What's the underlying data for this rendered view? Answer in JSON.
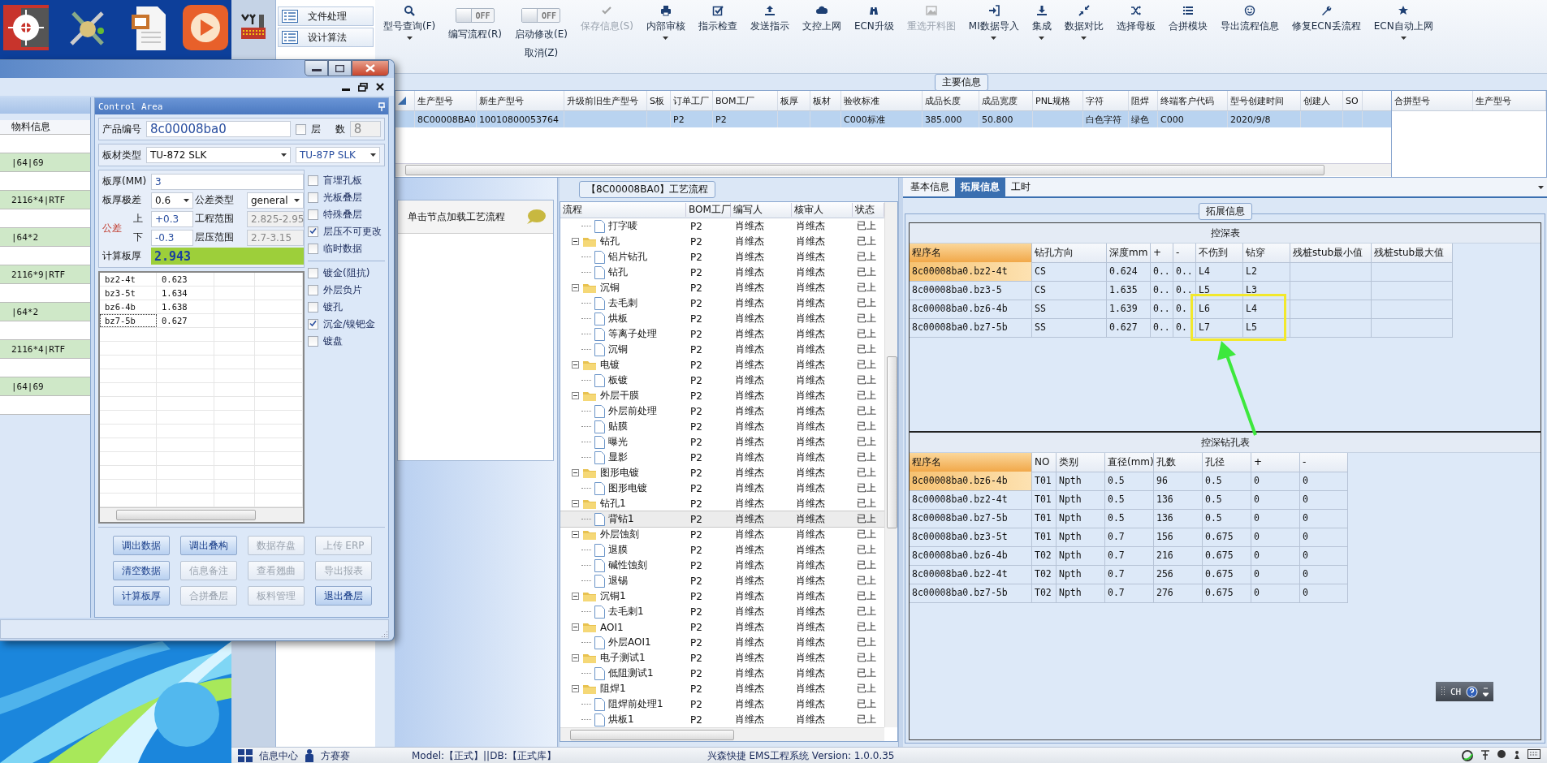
{
  "nav_menu": [
    {
      "label": "文件处理",
      "selected": false
    },
    {
      "label": "设计算法",
      "selected": false
    }
  ],
  "toolbar": [
    {
      "kind": "button",
      "label": "型号查询(F)",
      "dropdown": true,
      "disabled": false
    },
    {
      "kind": "toggle",
      "switch": "OFF",
      "on": false,
      "label": "编写流程(R)"
    },
    {
      "kind": "toggle",
      "switch": "OFF",
      "on": false,
      "label": "启动修改(E)",
      "sublabel": "取消(Z)"
    },
    {
      "kind": "button",
      "label": "保存信息(S)",
      "dropdown": false,
      "disabled": true
    },
    {
      "kind": "button",
      "label": "内部审核",
      "dropdown": true,
      "disabled": false
    },
    {
      "kind": "button",
      "label": "指示检查",
      "dropdown": false,
      "disabled": false
    },
    {
      "kind": "button",
      "label": "发送指示",
      "dropdown": false,
      "disabled": false
    },
    {
      "kind": "button",
      "label": "文控上网",
      "dropdown": false,
      "disabled": false
    },
    {
      "kind": "button",
      "label": "ECN升级",
      "dropdown": false,
      "disabled": false
    },
    {
      "kind": "button",
      "label": "重选开料图",
      "dropdown": false,
      "disabled": true
    },
    {
      "kind": "button",
      "label": "MI数据导入",
      "dropdown": true,
      "disabled": false
    },
    {
      "kind": "button",
      "label": "集成",
      "dropdown": true,
      "disabled": false
    },
    {
      "kind": "button",
      "label": "数据对比",
      "dropdown": true,
      "disabled": false
    },
    {
      "kind": "button",
      "label": "选择母板",
      "dropdown": false,
      "disabled": false
    },
    {
      "kind": "button",
      "label": "合拼模块",
      "dropdown": false,
      "disabled": false
    },
    {
      "kind": "button",
      "label": "导出流程信息",
      "dropdown": false,
      "disabled": false
    },
    {
      "kind": "button",
      "label": "修复ECN丢流程",
      "dropdown": false,
      "disabled": false
    },
    {
      "kind": "button",
      "label": "ECN自动上网",
      "dropdown": true,
      "disabled": false
    }
  ],
  "main_info": {
    "title": "主要信息",
    "columns": [
      "生产型号",
      "新生产型号",
      "升级前旧生产型号",
      "S板",
      "订单工厂",
      "BOM工厂",
      "板厚",
      "板材",
      "验收标准",
      "成品长度",
      "成品宽度",
      "PNL规格",
      "字符",
      "阻焊",
      "终端客户代码",
      "型号创建时间",
      "创建人",
      "SO"
    ],
    "rows": [
      {
        "selected": true,
        "cells": [
          "8C00008BA0",
          "10010800053764",
          null,
          null,
          "P2",
          "P2",
          null,
          null,
          "C000标准",
          "385.000",
          "50.800",
          null,
          "白色字符",
          "绿色",
          "C000",
          "2020/9/8",
          null,
          null
        ]
      }
    ],
    "side_columns": [
      "合拼型号",
      "生产型号"
    ]
  },
  "process": {
    "title": "【8C00008BA0】工艺流程",
    "hint": "单击节点加载工艺流程",
    "columns": [
      "流程",
      "BOM工厂",
      "编写人",
      "核审人",
      "状态"
    ],
    "nodes": [
      {
        "kind": "step",
        "name": "打字唛",
        "bom": "P2",
        "writer": "肖维杰",
        "reviewer": "肖维杰",
        "status": "已上",
        "selected": false
      },
      {
        "kind": "folder",
        "name": "钻孔",
        "bom": "P2",
        "writer": "肖维杰",
        "reviewer": "肖维杰",
        "status": "已上",
        "selected": false,
        "expanded": true,
        "children": [
          {
            "kind": "step",
            "name": "铝片钻孔",
            "bom": "P2",
            "writer": "肖维杰",
            "reviewer": "肖维杰",
            "status": "已上",
            "selected": false
          },
          {
            "kind": "step",
            "name": "钻孔",
            "bom": "P2",
            "writer": "肖维杰",
            "reviewer": "肖维杰",
            "status": "已上",
            "selected": false
          }
        ]
      },
      {
        "kind": "folder",
        "name": "沉铜",
        "bom": "P2",
        "writer": "肖维杰",
        "reviewer": "肖维杰",
        "status": "已上",
        "selected": false,
        "expanded": true,
        "children": [
          {
            "kind": "step",
            "name": "去毛刺",
            "bom": "P2",
            "writer": "肖维杰",
            "reviewer": "肖维杰",
            "status": "已上",
            "selected": false
          },
          {
            "kind": "step",
            "name": "烘板",
            "bom": "P2",
            "writer": "肖维杰",
            "reviewer": "肖维杰",
            "status": "已上",
            "selected": false
          },
          {
            "kind": "step",
            "name": "等离子处理",
            "bom": "P2",
            "writer": "肖维杰",
            "reviewer": "肖维杰",
            "status": "已上",
            "selected": false
          },
          {
            "kind": "step",
            "name": "沉铜",
            "bom": "P2",
            "writer": "肖维杰",
            "reviewer": "肖维杰",
            "status": "已上",
            "selected": false
          }
        ]
      },
      {
        "kind": "folder",
        "name": "电镀",
        "bom": "P2",
        "writer": "肖维杰",
        "reviewer": "肖维杰",
        "status": "已上",
        "selected": false,
        "expanded": true,
        "children": [
          {
            "kind": "step",
            "name": "板镀",
            "bom": "P2",
            "writer": "肖维杰",
            "reviewer": "肖维杰",
            "status": "已上",
            "selected": false
          }
        ]
      },
      {
        "kind": "folder",
        "name": "外层干膜",
        "bom": "P2",
        "writer": "肖维杰",
        "reviewer": "肖维杰",
        "status": "已上",
        "selected": false,
        "expanded": true,
        "children": [
          {
            "kind": "step",
            "name": "外层前处理",
            "bom": "P2",
            "writer": "肖维杰",
            "reviewer": "肖维杰",
            "status": "已上",
            "selected": false
          },
          {
            "kind": "step",
            "name": "贴膜",
            "bom": "P2",
            "writer": "肖维杰",
            "reviewer": "肖维杰",
            "status": "已上",
            "selected": false
          },
          {
            "kind": "step",
            "name": "曝光",
            "bom": "P2",
            "writer": "肖维杰",
            "reviewer": "肖维杰",
            "status": "已上",
            "selected": false
          },
          {
            "kind": "step",
            "name": "显影",
            "bom": "P2",
            "writer": "肖维杰",
            "reviewer": "肖维杰",
            "status": "已上",
            "selected": false
          }
        ]
      },
      {
        "kind": "folder",
        "name": "图形电镀",
        "bom": "P2",
        "writer": "肖维杰",
        "reviewer": "肖维杰",
        "status": "已上",
        "selected": false,
        "expanded": true,
        "children": [
          {
            "kind": "step",
            "name": "图形电镀",
            "bom": "P2",
            "writer": "肖维杰",
            "reviewer": "肖维杰",
            "status": "已上",
            "selected": false
          }
        ]
      },
      {
        "kind": "folder",
        "name": "钻孔1",
        "bom": "P2",
        "writer": "肖维杰",
        "reviewer": "肖维杰",
        "status": "已上",
        "selected": false,
        "expanded": true,
        "children": [
          {
            "kind": "step",
            "name": "背钻1",
            "bom": "P2",
            "writer": "肖维杰",
            "reviewer": "肖维杰",
            "status": "已上",
            "selected": true
          }
        ]
      },
      {
        "kind": "folder",
        "name": "外层蚀刻",
        "bom": "P2",
        "writer": "肖维杰",
        "reviewer": "肖维杰",
        "status": "已上",
        "selected": false,
        "expanded": true,
        "children": [
          {
            "kind": "step",
            "name": "退膜",
            "bom": "P2",
            "writer": "肖维杰",
            "reviewer": "肖维杰",
            "status": "已上",
            "selected": false
          },
          {
            "kind": "step",
            "name": "碱性蚀刻",
            "bom": "P2",
            "writer": "肖维杰",
            "reviewer": "肖维杰",
            "status": "已上",
            "selected": false
          },
          {
            "kind": "step",
            "name": "退锡",
            "bom": "P2",
            "writer": "肖维杰",
            "reviewer": "肖维杰",
            "status": "已上",
            "selected": false
          }
        ]
      },
      {
        "kind": "folder",
        "name": "沉铜1",
        "bom": "P2",
        "writer": "肖维杰",
        "reviewer": "肖维杰",
        "status": "已上",
        "selected": false,
        "expanded": true,
        "children": [
          {
            "kind": "step",
            "name": "去毛刺1",
            "bom": "P2",
            "writer": "肖维杰",
            "reviewer": "肖维杰",
            "status": "已上",
            "selected": false
          }
        ]
      },
      {
        "kind": "folder",
        "name": "AOI1",
        "bom": "P2",
        "writer": "肖维杰",
        "reviewer": "肖维杰",
        "status": "已上",
        "selected": false,
        "expanded": true,
        "children": [
          {
            "kind": "step",
            "name": "外层AOI1",
            "bom": "P2",
            "writer": "肖维杰",
            "reviewer": "肖维杰",
            "status": "已上",
            "selected": false
          }
        ]
      },
      {
        "kind": "folder",
        "name": "电子测试1",
        "bom": "P2",
        "writer": "肖维杰",
        "reviewer": "肖维杰",
        "status": "已上",
        "selected": false,
        "expanded": true,
        "children": [
          {
            "kind": "step",
            "name": "低阻测试1",
            "bom": "P2",
            "writer": "肖维杰",
            "reviewer": "肖维杰",
            "status": "已上",
            "selected": false
          }
        ]
      },
      {
        "kind": "folder",
        "name": "阻焊1",
        "bom": "P2",
        "writer": "肖维杰",
        "reviewer": "肖维杰",
        "status": "已上",
        "selected": false,
        "expanded": true,
        "children": [
          {
            "kind": "step",
            "name": "阻焊前处理1",
            "bom": "P2",
            "writer": "肖维杰",
            "reviewer": "肖维杰",
            "status": "已上",
            "selected": false
          },
          {
            "kind": "step",
            "name": "烘板1",
            "bom": "P2",
            "writer": "肖维杰",
            "reviewer": "肖维杰",
            "status": "已上",
            "selected": false
          }
        ]
      }
    ]
  },
  "detail": {
    "tabs": [
      {
        "label": "基本信息",
        "selected": false
      },
      {
        "label": "拓展信息",
        "selected": true
      },
      {
        "label": "工时",
        "selected": false
      }
    ],
    "group_title": "拓展信息",
    "depth_table": {
      "title": "控深表",
      "columns": [
        {
          "label": "程序名",
          "sorted": true
        },
        {
          "label": "钻孔方向",
          "sorted": false
        },
        {
          "label": "深度mm",
          "sorted": false
        },
        {
          "label": "+",
          "sorted": false
        },
        {
          "label": "-",
          "sorted": false
        },
        {
          "label": "不伤到",
          "sorted": false
        },
        {
          "label": "钻穿",
          "sorted": false
        },
        {
          "label": "残桩stub最小值",
          "sorted": false
        },
        {
          "label": "残桩stub最大值",
          "sorted": false
        }
      ],
      "rows": [
        {
          "selected": true,
          "cells": [
            "8c00008ba0.bz2-4t",
            "CS",
            "0.624",
            "0..",
            "0..",
            "L4",
            "L2",
            null,
            null
          ]
        },
        {
          "selected": false,
          "cells": [
            "8c00008ba0.bz3-5",
            "CS",
            "1.635",
            "0..",
            "0..",
            "L5",
            "L3",
            null,
            null
          ]
        },
        {
          "selected": false,
          "cells": [
            "8c00008ba0.bz6-4b",
            "SS",
            "1.639",
            "0..",
            "0.",
            "L6",
            "L4",
            null,
            null
          ]
        },
        {
          "selected": false,
          "cells": [
            "8c00008ba0.bz7-5b",
            "SS",
            "0.627",
            "0..",
            "0.",
            "L7",
            "L5",
            null,
            null
          ]
        }
      ]
    },
    "drill_table": {
      "title": "控深钻孔表",
      "columns": [
        {
          "label": "程序名",
          "sorted": true
        },
        {
          "label": "NO",
          "sorted": false
        },
        {
          "label": "类别",
          "sorted": false
        },
        {
          "label": "直径(mm)",
          "sorted": false
        },
        {
          "label": "孔数",
          "sorted": false
        },
        {
          "label": "孔径",
          "sorted": false
        },
        {
          "label": "+",
          "sorted": false
        },
        {
          "label": "-",
          "sorted": false
        }
      ],
      "rows": [
        {
          "selected": true,
          "cells": [
            "8c00008ba0.bz6-4b",
            "T01",
            "Npth",
            "0.5",
            "96",
            "0.5",
            "0",
            "0"
          ]
        },
        {
          "selected": false,
          "cells": [
            "8c00008ba0.bz2-4t",
            "T01",
            "Npth",
            "0.5",
            "136",
            "0.5",
            "0",
            "0"
          ]
        },
        {
          "selected": false,
          "cells": [
            "8c00008ba0.bz7-5b",
            "T01",
            "Npth",
            "0.5",
            "136",
            "0.5",
            "0",
            "0"
          ]
        },
        {
          "selected": false,
          "cells": [
            "8c00008ba0.bz3-5t",
            "T01",
            "Npth",
            "0.7",
            "156",
            "0.675",
            "0",
            "0"
          ]
        },
        {
          "selected": false,
          "cells": [
            "8c00008ba0.bz6-4b",
            "T02",
            "Npth",
            "0.7",
            "216",
            "0.675",
            "0",
            "0"
          ]
        },
        {
          "selected": false,
          "cells": [
            "8c00008ba0.bz2-4t",
            "T02",
            "Npth",
            "0.7",
            "256",
            "0.675",
            "0",
            "0"
          ]
        },
        {
          "selected": false,
          "cells": [
            "8c00008ba0.bz7-5b",
            "T02",
            "Npth",
            "0.7",
            "276",
            "0.675",
            "0",
            "0"
          ]
        }
      ]
    }
  },
  "ime": {
    "label": "CH"
  },
  "status_bar": {
    "info_center": "信息中心",
    "user": "方赛赛",
    "env": "Model:【正式】||DB:【正式库】",
    "version": "兴森快捷 EMS工程系统 Version: 1.0.0.35"
  },
  "stackup_window": {
    "material_column": "物料信息",
    "materials": [
      "|64|69",
      "2116*4|RTF",
      "|64*2",
      "2116*9|RTF",
      "|64*2",
      "2116*4|RTF",
      "|64|69"
    ],
    "panel_title": "Control Area",
    "product_no": {
      "label": "产品编号",
      "value": "8c00008ba0"
    },
    "layer_count": {
      "label": "层 数",
      "checked": false,
      "value": "8"
    },
    "material_type": {
      "label": "板材类型",
      "value": "TU-872 SLK",
      "value2": "TU-87P SLK"
    },
    "thickness": {
      "label": "板厚(MM)",
      "value": "3"
    },
    "thickness_tol": {
      "label": "板厚极差",
      "value": "0.6"
    },
    "tol_type": {
      "label": "公差类型",
      "value": "general"
    },
    "tolerance": {
      "label": "公差",
      "upper_label": "上",
      "upper": "+0.3",
      "lower_label": "下",
      "lower": "-0.3"
    },
    "eng_range": {
      "label": "工程范围",
      "value": "2.825-2.95"
    },
    "press_range": {
      "label": "层压范围",
      "value": "2.7-3.15"
    },
    "calc": {
      "label": "计算板厚",
      "value": "2.943"
    },
    "options": [
      {
        "label": "盲埋孔板",
        "checked": false
      },
      {
        "label": "光板叠层",
        "checked": false
      },
      {
        "label": "特殊叠层",
        "checked": false
      },
      {
        "label": "层压不可更改",
        "checked": true
      },
      {
        "label": "临时数据",
        "checked": false
      }
    ],
    "options2": [
      {
        "label": "镀金(阻抗)",
        "checked": false
      },
      {
        "label": "外层负片",
        "checked": false
      },
      {
        "label": "镀孔",
        "checked": false
      },
      {
        "label": "沉金/镍钯金",
        "checked": true
      },
      {
        "label": "镀盘",
        "checked": false
      }
    ],
    "layers_grid": [
      {
        "name": "bz2-4t",
        "value": "0.623",
        "focused": false
      },
      {
        "name": "bz3-5t",
        "value": "1.634",
        "focused": false
      },
      {
        "name": "bz6-4b",
        "value": "1.638",
        "focused": false
      },
      {
        "name": "bz7-5b",
        "value": "0.627",
        "focused": true
      }
    ],
    "buttons": [
      {
        "label": "调出数据",
        "disabled": false
      },
      {
        "label": "调出叠构",
        "disabled": false
      },
      {
        "label": "数据存盘",
        "disabled": true
      },
      {
        "label": "上传 ERP",
        "disabled": true
      },
      {
        "label": "清空数据",
        "disabled": false
      },
      {
        "label": "信息备注",
        "disabled": true
      },
      {
        "label": "查看翘曲",
        "disabled": true
      },
      {
        "label": "导出报表",
        "disabled": true
      },
      {
        "label": "计算板厚",
        "disabled": false
      },
      {
        "label": "合拼叠层",
        "disabled": true
      },
      {
        "label": "板料管理",
        "disabled": true
      },
      {
        "label": "退出叠层",
        "disabled": false
      }
    ]
  }
}
